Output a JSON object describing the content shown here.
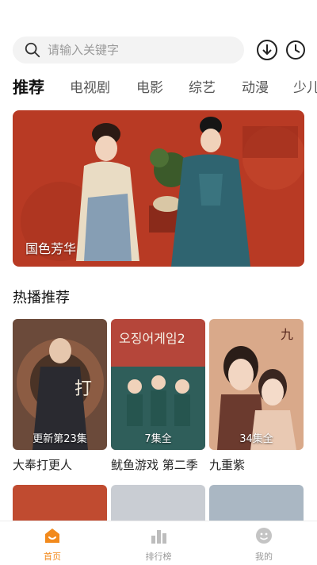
{
  "search": {
    "placeholder": "请输入关键字"
  },
  "tabs": [
    "推荐",
    "电视剧",
    "电影",
    "综艺",
    "动漫",
    "少儿"
  ],
  "banner": {
    "title": "国色芳华"
  },
  "section": {
    "title": "热播推荐"
  },
  "cards": [
    {
      "title": "大奉打更人",
      "badge": "更新第23集"
    },
    {
      "title": "鱿鱼游戏 第二季",
      "badge": "7集全"
    },
    {
      "title": "九重紫",
      "badge": "34集全"
    }
  ],
  "nav": [
    {
      "label": "首页",
      "icon": "home-icon"
    },
    {
      "label": "排行榜",
      "icon": "rank-icon"
    },
    {
      "label": "我的",
      "icon": "profile-icon"
    }
  ],
  "colors": {
    "accent": "#f28a1d",
    "banner_bg": "#b83a24"
  }
}
